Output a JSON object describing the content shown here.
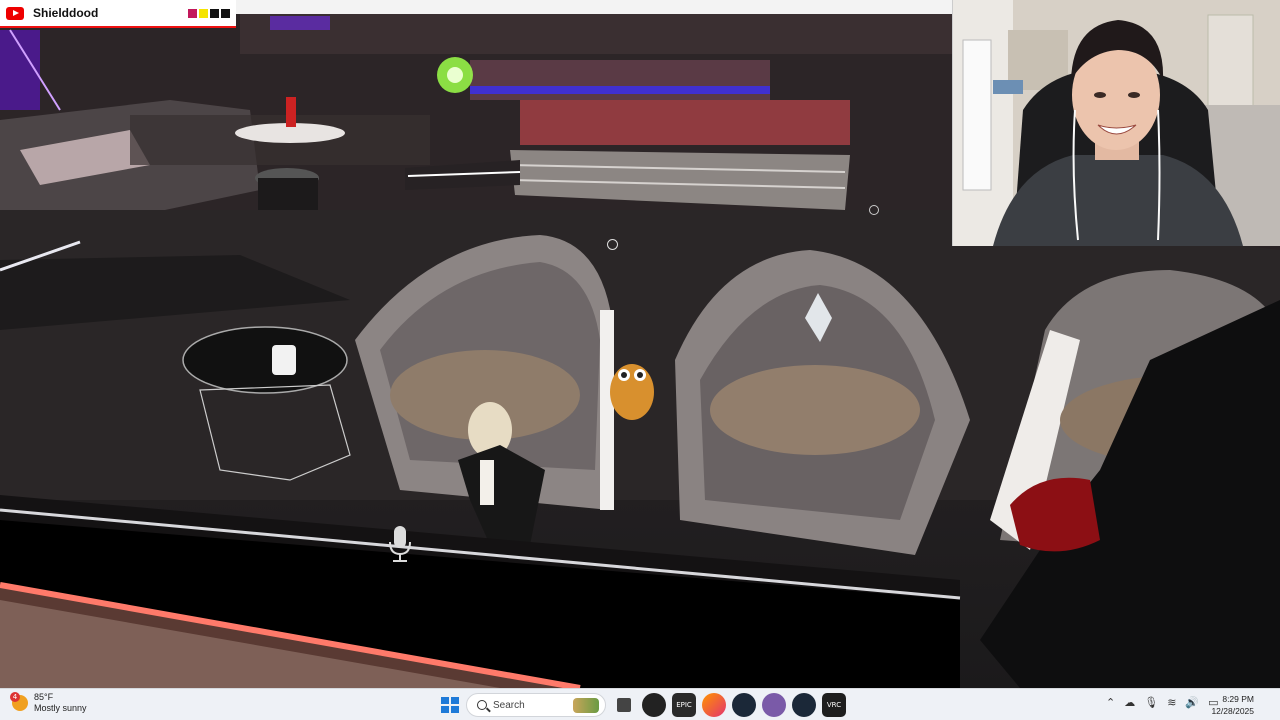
{
  "overlay": {
    "channel_name": "Shielddood",
    "brand_icon": "youtube-icon",
    "swatches": [
      "#c2185b",
      "#f5e400",
      "#111111",
      "#111111"
    ]
  },
  "game": {
    "mic_icon": "microphone-icon",
    "reticle_icon": "circle-reticle-icon"
  },
  "webcam": {
    "label": "streamer-webcam"
  },
  "taskbar": {
    "weather": {
      "badge": "4",
      "temp": "85°F",
      "condition": "Mostly sunny"
    },
    "search_placeholder": "Search",
    "apps": [
      {
        "name": "start-icon"
      },
      {
        "name": "task-view-icon"
      },
      {
        "name": "obs-icon"
      },
      {
        "name": "epic-games-icon",
        "label": "EPIC"
      },
      {
        "name": "firefox-icon"
      },
      {
        "name": "steam-icon"
      },
      {
        "name": "discord-icon"
      },
      {
        "name": "steam-icon-2"
      },
      {
        "name": "vrchat-icon",
        "label": "VRC"
      }
    ],
    "tray_icons": [
      "chevron-up-icon",
      "cloud-icon",
      "microphone-icon",
      "wifi-icon",
      "volume-icon",
      "battery-icon"
    ],
    "time": "8:29 PM",
    "date": "12/28/2025",
    "colors": {
      "taskbar_bg": "#eef1f6",
      "accent": "#1f7ad8"
    }
  }
}
